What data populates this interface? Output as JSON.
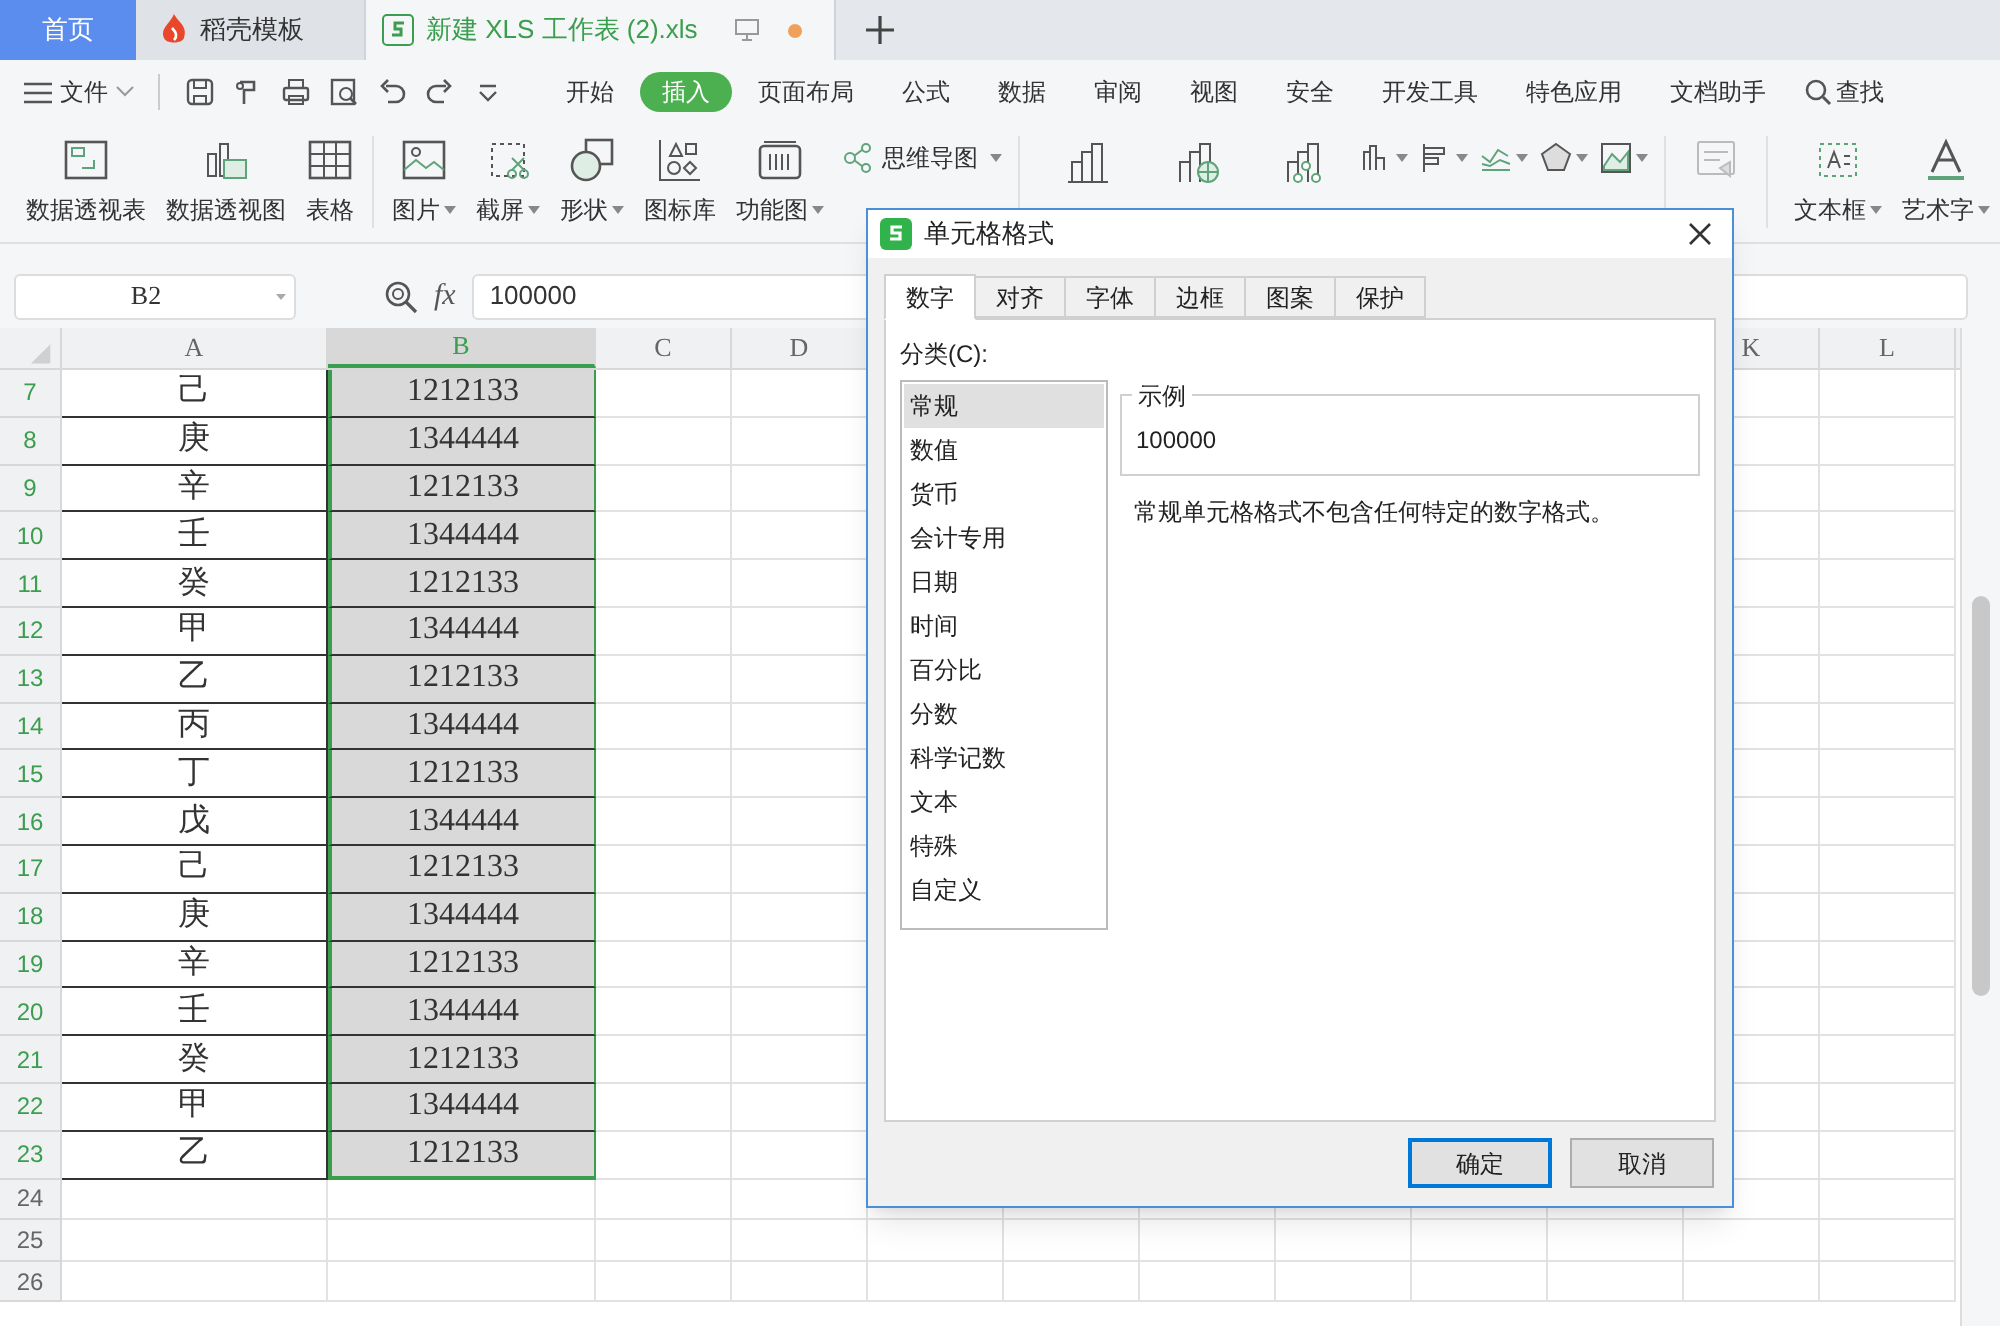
{
  "doc_tabs": [
    {
      "label": "首页",
      "selected": false,
      "kind": "home"
    },
    {
      "label": "稻壳模板",
      "selected": false,
      "kind": "template"
    },
    {
      "label": "新建 XLS 工作表 (2).xls",
      "selected": true,
      "kind": "sheet",
      "unsaved": true
    }
  ],
  "menu": {
    "file": "文件",
    "tabs": [
      {
        "label": "开始",
        "selected": false
      },
      {
        "label": "插入",
        "selected": true
      },
      {
        "label": "页面布局",
        "selected": false
      },
      {
        "label": "公式",
        "selected": false
      },
      {
        "label": "数据",
        "selected": false
      },
      {
        "label": "审阅",
        "selected": false
      },
      {
        "label": "视图",
        "selected": false
      },
      {
        "label": "安全",
        "selected": false
      },
      {
        "label": "开发工具",
        "selected": false
      },
      {
        "label": "特色应用",
        "selected": false
      },
      {
        "label": "文档助手",
        "selected": false
      }
    ],
    "search": "查找"
  },
  "ribbon": {
    "items": [
      {
        "label": "数据透视表",
        "dropdown": false,
        "disabled": false
      },
      {
        "label": "数据透视图",
        "dropdown": false,
        "disabled": false
      },
      {
        "label": "表格",
        "dropdown": false,
        "disabled": false
      },
      {
        "label": "图片",
        "dropdown": true,
        "disabled": false
      },
      {
        "label": "截屏",
        "dropdown": true,
        "disabled": false
      },
      {
        "label": "形状",
        "dropdown": true,
        "disabled": false
      },
      {
        "label": "图标库",
        "dropdown": false,
        "disabled": false
      },
      {
        "label": "功能图",
        "dropdown": true,
        "disabled": false
      }
    ],
    "mind_map": {
      "label": "思维导图",
      "dropdown": true
    },
    "slicer": {
      "disabled": true
    },
    "right_items": [
      {
        "label": "文本框",
        "dropdown": true
      },
      {
        "label": "艺术字",
        "dropdown": true
      }
    ]
  },
  "formula_bar": {
    "cell": "B2",
    "fx": "fx",
    "value": "100000"
  },
  "sheet": {
    "columns": [
      {
        "label": "A",
        "selected": false
      },
      {
        "label": "B",
        "selected": true
      },
      {
        "label": "C",
        "selected": false
      },
      {
        "label": "D",
        "selected": false
      },
      {
        "label": "K",
        "selected": false
      },
      {
        "label": "L",
        "selected": false
      }
    ],
    "rows": [
      {
        "number": "7",
        "selected": true,
        "cells": [
          "己",
          "1212133"
        ]
      },
      {
        "number": "8",
        "selected": true,
        "cells": [
          "庚",
          "1344444"
        ]
      },
      {
        "number": "9",
        "selected": true,
        "cells": [
          "辛",
          "1212133"
        ]
      },
      {
        "number": "10",
        "selected": true,
        "cells": [
          "壬",
          "1344444"
        ]
      },
      {
        "number": "11",
        "selected": true,
        "cells": [
          "癸",
          "1212133"
        ]
      },
      {
        "number": "12",
        "selected": true,
        "cells": [
          "甲",
          "1344444"
        ]
      },
      {
        "number": "13",
        "selected": true,
        "cells": [
          "乙",
          "1212133"
        ]
      },
      {
        "number": "14",
        "selected": true,
        "cells": [
          "丙",
          "1344444"
        ]
      },
      {
        "number": "15",
        "selected": true,
        "cells": [
          "丁",
          "1212133"
        ]
      },
      {
        "number": "16",
        "selected": true,
        "cells": [
          "戊",
          "1344444"
        ]
      },
      {
        "number": "17",
        "selected": true,
        "cells": [
          "己",
          "1212133"
        ]
      },
      {
        "number": "18",
        "selected": true,
        "cells": [
          "庚",
          "1344444"
        ]
      },
      {
        "number": "19",
        "selected": true,
        "cells": [
          "辛",
          "1212133"
        ]
      },
      {
        "number": "20",
        "selected": true,
        "cells": [
          "壬",
          "1344444"
        ]
      },
      {
        "number": "21",
        "selected": true,
        "cells": [
          "癸",
          "1212133"
        ]
      },
      {
        "number": "22",
        "selected": true,
        "cells": [
          "甲",
          "1344444"
        ]
      },
      {
        "number": "23",
        "selected": true,
        "cells": [
          "乙",
          "1212133"
        ]
      },
      {
        "number": "24",
        "selected": false,
        "cells": []
      },
      {
        "number": "25",
        "selected": false,
        "cells": []
      },
      {
        "number": "26",
        "selected": false,
        "cells": []
      }
    ]
  },
  "dialog": {
    "title": "单元格格式",
    "tabs": [
      {
        "label": "数字",
        "selected": true
      },
      {
        "label": "对齐",
        "selected": false
      },
      {
        "label": "字体",
        "selected": false
      },
      {
        "label": "边框",
        "selected": false
      },
      {
        "label": "图案",
        "selected": false
      },
      {
        "label": "保护",
        "selected": false
      }
    ],
    "category_label": "分类(C):",
    "categories": [
      {
        "label": "常规",
        "selected": true
      },
      {
        "label": "数值",
        "selected": false
      },
      {
        "label": "货币",
        "selected": false
      },
      {
        "label": "会计专用",
        "selected": false
      },
      {
        "label": "日期",
        "selected": false
      },
      {
        "label": "时间",
        "selected": false
      },
      {
        "label": "百分比",
        "selected": false
      },
      {
        "label": "分数",
        "selected": false
      },
      {
        "label": "科学记数",
        "selected": false
      },
      {
        "label": "文本",
        "selected": false
      },
      {
        "label": "特殊",
        "selected": false
      },
      {
        "label": "自定义",
        "selected": false
      }
    ],
    "sample_label": "示例",
    "sample_value": "100000",
    "description": "常规单元格格式不包含任何特定的数字格式。",
    "buttons": [
      {
        "label": "确定",
        "default": true
      },
      {
        "label": "取消",
        "default": false
      }
    ]
  }
}
